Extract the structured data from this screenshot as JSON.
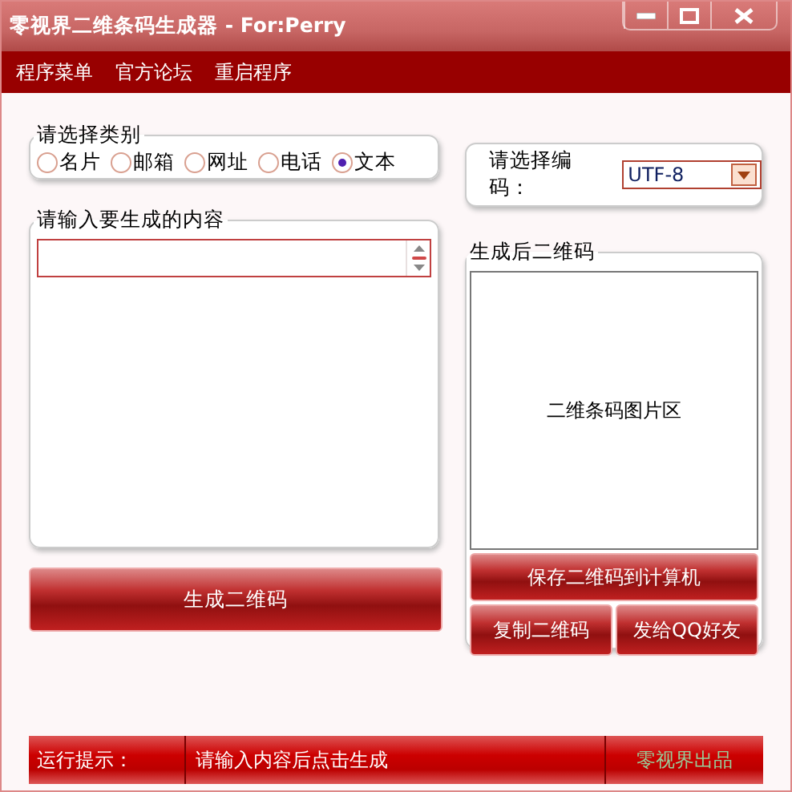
{
  "window": {
    "title": "零视界二维条码生成器 - For:Perry"
  },
  "menu": [
    "程序菜单",
    "官方论坛",
    "重启程序"
  ],
  "category": {
    "legend": "请选择类别",
    "options": [
      {
        "label": "名片",
        "selected": false
      },
      {
        "label": "邮箱",
        "selected": false
      },
      {
        "label": "网址",
        "selected": false
      },
      {
        "label": "电话",
        "selected": false
      },
      {
        "label": "文本",
        "selected": true
      }
    ]
  },
  "encoding": {
    "label": "请选择编码：",
    "value": "UTF-8"
  },
  "content": {
    "legend": "请输入要生成的内容"
  },
  "qr": {
    "legend": "生成后二维码",
    "placeholder_text": "二维条码图片区"
  },
  "buttons": {
    "generate": "生成二维码",
    "save": "保存二维码到计算机",
    "copy": "复制二维码",
    "send": "发给QQ好友"
  },
  "status_bar": {
    "label": "运行提示：",
    "message": "请输入内容后点击生成",
    "credit": "零视界出品"
  }
}
